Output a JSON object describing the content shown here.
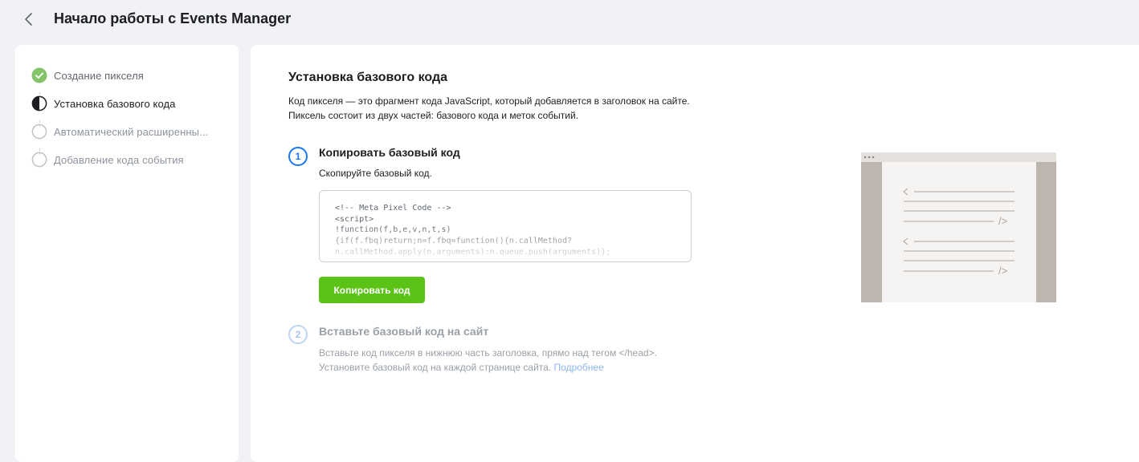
{
  "header": {
    "title": "Начало работы с Events Manager",
    "back_icon": "chevron-left-icon"
  },
  "sidebar": {
    "steps": [
      {
        "label": "Создание пикселя",
        "state": "done",
        "icon": "check-circle-icon"
      },
      {
        "label": "Установка базового кода",
        "state": "active",
        "icon": "half-circle-icon"
      },
      {
        "label": "Автоматический расширенны...",
        "state": "pending",
        "icon": "empty-circle-icon"
      },
      {
        "label": "Добавление кода события",
        "state": "pending",
        "icon": "empty-circle-icon"
      }
    ]
  },
  "main": {
    "title": "Установка базового кода",
    "intro_lines": [
      "Код пикселя — это фрагмент кода JavaScript, который добавляется в заголовок на сайте.",
      "Пиксель состоит из двух частей: базового кода и меток событий."
    ],
    "step1": {
      "number": "1",
      "title": "Копировать базовый код",
      "description": "Скопируйте базовый код.",
      "code_lines": [
        "<!-- Meta Pixel Code -->",
        "<script>",
        "!function(f,b,e,v,n,t,s)",
        "{if(f.fbq)return;n=f.fbq=function(){n.callMethod?",
        "n.callMethod.apply(n,arguments):n.queue.push(arguments)};"
      ],
      "button_label": "Копировать код"
    },
    "step2": {
      "number": "2",
      "title": "Вставьте базовый код на сайт",
      "line1": "Вставьте код пикселя в нижнюю часть заголовка, прямо над тегом </head>.",
      "line2": "Установите базовый код на каждой странице сайта.",
      "link_label": "Подробнее"
    },
    "illustration": {
      "icon": "browser-code-illustration",
      "code_tag_open": "<",
      "code_tag_close": "/>"
    }
  },
  "colors": {
    "accent": "#1877f2",
    "success": "#5ac316",
    "check_green": "#84c36a",
    "background": "#f0f2f5",
    "link": "#8bb6ee"
  }
}
